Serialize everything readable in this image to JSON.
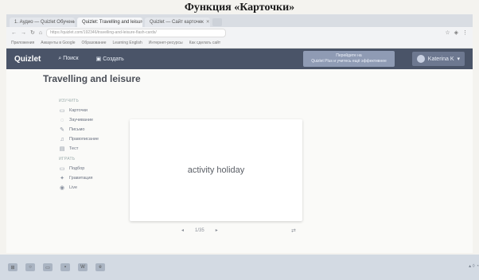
{
  "slide": {
    "title": "Функция «Карточки»"
  },
  "browser": {
    "tabs": [
      {
        "label": "1. Аудио — Quizlet Обучение",
        "active": false
      },
      {
        "label": "Quizlet: Travelling and leisure",
        "active": true
      },
      {
        "label": "Quizlet — Сайт карточек",
        "active": false
      }
    ],
    "url": "https://quizlet.com/192346/travelling-and-leisure-flash-cards/",
    "bookmarks": [
      "Приложения",
      "Аккаунты в Google",
      "Образование",
      "Learning English",
      "Интернет-ресурсы",
      "Как сделать сайт"
    ]
  },
  "quizlet": {
    "logo": "Quizlet",
    "search": "Поиск",
    "create": "Создать",
    "upgrade_line1": "Перейдите на",
    "upgrade_line2": "Quizlet Plus и учитесь ещё эффективнее",
    "user": "Katerina K"
  },
  "set": {
    "title": "Travelling and leisure",
    "study_label": "ИЗУЧИТЬ",
    "modes": [
      {
        "icon": "cards-icon",
        "glyph": "▭",
        "label": "Карточки"
      },
      {
        "icon": "learn-icon",
        "glyph": "◌",
        "label": "Заучивание"
      },
      {
        "icon": "write-icon",
        "glyph": "✎",
        "label": "Письмо"
      },
      {
        "icon": "spell-icon",
        "glyph": "♫",
        "label": "Правописание"
      },
      {
        "icon": "test-icon",
        "glyph": "▤",
        "label": "Тест"
      }
    ],
    "play_label": "ИГРАТЬ",
    "games": [
      {
        "icon": "match-icon",
        "glyph": "▭",
        "label": "Подбор"
      },
      {
        "icon": "gravity-icon",
        "glyph": "✦",
        "label": "Гравитация"
      },
      {
        "icon": "live-icon",
        "glyph": "◉",
        "label": "Live"
      }
    ],
    "card_text": "activity holiday",
    "progress": "1/35"
  }
}
